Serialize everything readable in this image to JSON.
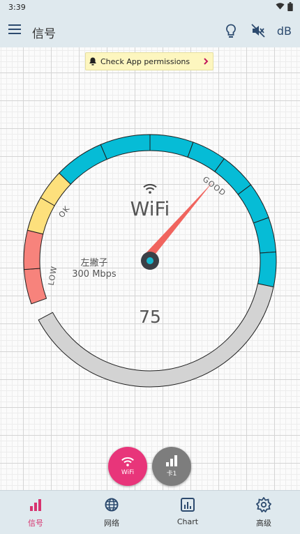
{
  "status": {
    "time": "3:39"
  },
  "toolbar": {
    "title": "信号",
    "db_label": "dB"
  },
  "permission_banner": {
    "text": "Check App permissions"
  },
  "gauge": {
    "network_type": "WiFi",
    "ssid": "左撇子",
    "link_speed": "300 Mbps",
    "signal_value": "75",
    "zone_labels": {
      "low": "LOW",
      "ok": "OK",
      "good": "GOOD"
    },
    "colors": {
      "low": "#f7837c",
      "ok": "#fde07c",
      "good": "#06bcd6",
      "unused": "#d3d3d3",
      "needle": "#f0645e",
      "hub": "#3a3f46",
      "hub_center": "#17b5cc"
    }
  },
  "fabs": {
    "wifi_label": "WiFi",
    "sim_label": "卡1"
  },
  "nav": [
    {
      "label": "信号",
      "icon": "bar-chart-icon",
      "active": true
    },
    {
      "label": "网络",
      "icon": "globe-icon",
      "active": false
    },
    {
      "label": "Chart",
      "icon": "chart-icon",
      "active": false
    },
    {
      "label": "高级",
      "icon": "advanced-gear-icon",
      "active": false
    }
  ],
  "accent_color": "#d7336f"
}
